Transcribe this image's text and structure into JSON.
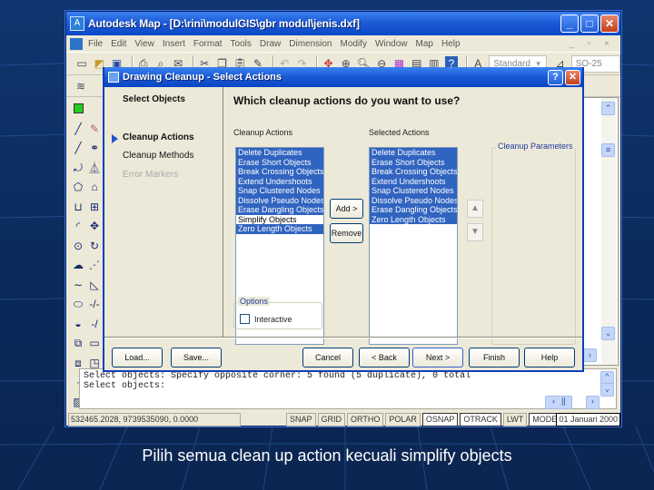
{
  "app": {
    "title": "Autodesk Map - [D:\\rini\\modulGIS\\gbr modul\\jenis.dxf]",
    "window_controls": {
      "minimize": "_",
      "maximize": "□",
      "close": "✕"
    },
    "menu": [
      "File",
      "Edit",
      "View",
      "Insert",
      "Format",
      "Tools",
      "Draw",
      "Dimension",
      "Modify",
      "Window",
      "Map",
      "Help"
    ],
    "mdi_controls": "_ ▫ ×",
    "toolbar": {
      "text_style_combo": "Standard",
      "dim_style_combo": "SO-25"
    },
    "command_line": [
      "Select objects: Specify opposite corner: 5 found (5 duplicate), 0 total",
      "Select objects:"
    ],
    "status_bar": {
      "coordinates": "532465.2028, 9739535090, 0.0000",
      "toggles": [
        {
          "label": "SNAP",
          "on": false
        },
        {
          "label": "GRID",
          "on": false
        },
        {
          "label": "ORTHO",
          "on": false
        },
        {
          "label": "POLAR",
          "on": false
        },
        {
          "label": "OSNAP",
          "on": true
        },
        {
          "label": "OTRACK",
          "on": true
        },
        {
          "label": "LWT",
          "on": false
        },
        {
          "label": "MODEL",
          "on": true
        }
      ],
      "date": "01 Januari 2000"
    }
  },
  "dialog": {
    "title": "Drawing Cleanup - Select Actions",
    "help_button": "?",
    "close_button": "✕",
    "steps": [
      {
        "label": "Select Objects",
        "state": "done"
      },
      {
        "label": "Cleanup Actions",
        "state": "active"
      },
      {
        "label": "Cleanup Methods",
        "state": "normal"
      },
      {
        "label": "Error Markers",
        "state": "disabled"
      }
    ],
    "question": "Which cleanup actions do you want to use?",
    "available_label": "Cleanup Actions",
    "selected_label": "Selected Actions",
    "parameters_label": "Cleanup Parameters",
    "available_actions": [
      {
        "label": "Delete Duplicates",
        "selected": true
      },
      {
        "label": "Erase Short Objects",
        "selected": true
      },
      {
        "label": "Break Crossing Objects",
        "selected": true
      },
      {
        "label": "Extend Undershoots",
        "selected": true
      },
      {
        "label": "Snap Clustered Nodes",
        "selected": true
      },
      {
        "label": "Dissolve Pseudo Nodes",
        "selected": true
      },
      {
        "label": "Erase Dangling Objects",
        "selected": true
      },
      {
        "label": "Simplify Objects",
        "selected": false
      },
      {
        "label": "Zero Length Objects",
        "selected": true
      }
    ],
    "selected_actions": [
      {
        "label": "Delete Duplicates",
        "selected": true
      },
      {
        "label": "Erase Short Objects",
        "selected": true
      },
      {
        "label": "Break Crossing Objects",
        "selected": true
      },
      {
        "label": "Extend Undershoots",
        "selected": true
      },
      {
        "label": "Snap Clustered Nodes",
        "selected": true
      },
      {
        "label": "Dissolve Pseudo Nodes",
        "selected": true
      },
      {
        "label": "Erase Dangling Objects",
        "selected": true
      },
      {
        "label": "Zero Length Objects",
        "selected": true
      }
    ],
    "add_button": "Add >",
    "remove_button": "Remove",
    "move_up": "▲",
    "move_down": "▼",
    "options_label": "Options",
    "interactive_label": "Interactive",
    "interactive_checked": false,
    "buttons": {
      "load": "Load...",
      "save": "Save...",
      "cancel": "Cancel",
      "back": "< Back",
      "next": "Next >",
      "finish": "Finish",
      "help": "Help"
    }
  },
  "slide": {
    "caption": "Pilih semua clean up action kecuali simplify objects"
  }
}
